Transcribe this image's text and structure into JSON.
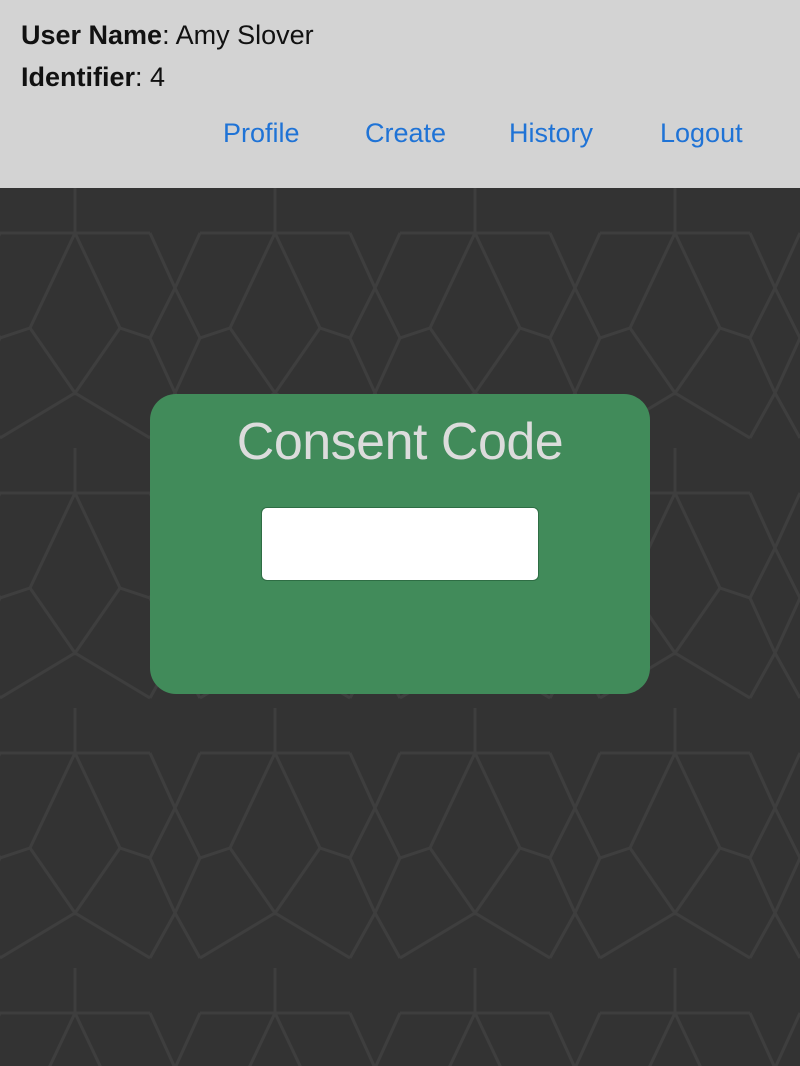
{
  "header": {
    "user_name_key": "User Name",
    "user_name_value": "Amy Slover",
    "identifier_key": "Identifier",
    "identifier_value": "4",
    "nav": {
      "profile": "Profile",
      "create": "Create",
      "history": "History",
      "logout": "Logout"
    }
  },
  "consent": {
    "title": "Consent Code",
    "code_digits": [
      "",
      "",
      "",
      ""
    ]
  },
  "colors": {
    "header_bg": "#d3d3d3",
    "link": "#1f73d6",
    "background": "#333333",
    "card": "#418b5a",
    "title_text": "#dcdcdc"
  }
}
